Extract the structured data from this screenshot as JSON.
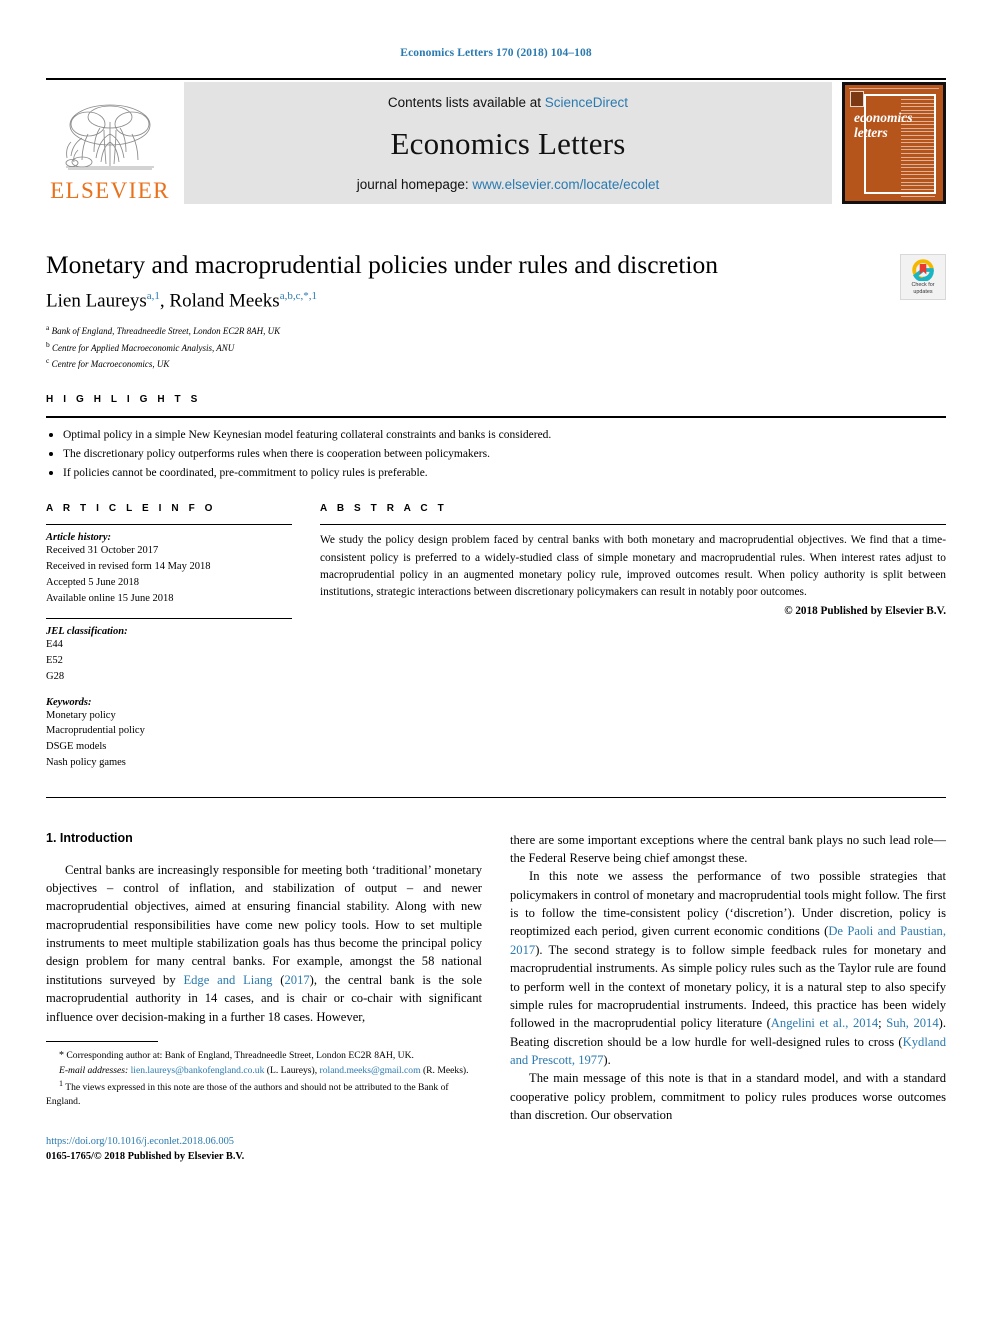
{
  "running_head": "Economics Letters 170 (2018) 104–108",
  "masthead": {
    "publisher_name": "ELSEVIER",
    "contents_prefix": "Contents lists available at",
    "contents_link": "ScienceDirect",
    "journal_name": "Economics Letters",
    "homepage_prefix": "journal homepage:",
    "homepage_link": "www.elsevier.com/locate/ecolet",
    "cover_title_line1": "economics",
    "cover_title_line2": "letters"
  },
  "title_block": {
    "title": "Monetary and macroprudential policies under rules and discretion",
    "authors_part1": "Lien Laureys",
    "authors_sup1": "a,1",
    "authors_sep": ", ",
    "authors_part2": "Roland Meeks",
    "authors_sup2": "a,b,c,*,1",
    "affiliations": [
      {
        "mark": "a",
        "text": "Bank of England, Threadneedle Street, London EC2R 8AH, UK"
      },
      {
        "mark": "b",
        "text": "Centre for Applied Macroeconomic Analysis, ANU"
      },
      {
        "mark": "c",
        "text": "Centre for Macroeconomics, UK"
      }
    ],
    "crossmark_line1": "Check for",
    "crossmark_line2": "updates"
  },
  "highlights": {
    "heading": "H I G H L I G H T S",
    "items": [
      "Optimal policy in a simple New Keynesian model featuring collateral constraints and banks is considered.",
      "The discretionary policy outperforms rules when there is cooperation between policymakers.",
      "If policies cannot be coordinated, pre-commitment to policy rules is preferable."
    ]
  },
  "article_info": {
    "heading": "A R T I C L E   I N F O",
    "history_label": "Article history:",
    "history": [
      "Received 31 October 2017",
      "Received in revised form 14 May 2018",
      "Accepted 5 June 2018",
      "Available online 15 June 2018"
    ],
    "jel_label": "JEL classification:",
    "jel_codes": [
      "E44",
      "E52",
      "G28"
    ],
    "keywords_label": "Keywords:",
    "keywords": [
      "Monetary policy",
      "Macroprudential policy",
      "DSGE models",
      "Nash policy games"
    ]
  },
  "abstract": {
    "heading": "A B S T R A C T",
    "text": "We study the policy design problem faced by central banks with both monetary and macroprudential objectives. We find that a time-consistent policy is preferred to a widely-studied class of simple monetary and macroprudential rules. When interest rates adjust to macroprudential policy in an augmented monetary policy rule, improved outcomes result. When policy authority is split between institutions, strategic interactions between discretionary policymakers can result in notably poor outcomes.",
    "copyright": "© 2018 Published by Elsevier B.V."
  },
  "body": {
    "section_title": "1. Introduction",
    "left_p1_a": "Central banks are increasingly responsible for meeting both ‘traditional’ monetary objectives – control of inflation, and stabilization of output – and newer macroprudential objectives, aimed at ensuring financial stability. Along with new macroprudential responsibilities have come new policy tools. How to set multiple instruments to meet multiple stabilization goals has thus become the principal policy design problem for many central banks. For example, amongst the 58 national institutions surveyed by ",
    "left_p1_cite1": "Edge and Liang",
    "left_p1_b": " (",
    "left_p1_cite2": "2017",
    "left_p1_c": "), the central bank is the sole macroprudential authority in 14 cases, and is chair or co-chair with significant influence over decision-making in a further 18 cases. However,",
    "right_p1": "there are some important exceptions where the central bank plays no such lead role—the Federal Reserve being chief amongst these.",
    "right_p2_a": "In this note we assess the performance of two possible strategies that policymakers in control of monetary and macroprudential tools might follow. The first is to follow the time-consistent policy (‘discretion’). Under discretion, policy is reoptimized each period, given current economic conditions (",
    "right_p2_cite1": "De Paoli and Paustian, 2017",
    "right_p2_b": "). The second strategy is to follow simple feedback rules for monetary and macroprudential instruments. As simple policy rules such as the Taylor rule are found to perform well in the context of monetary policy, it is a natural step to also specify simple rules for macroprudential instruments. Indeed, this practice has been widely followed in the macroprudential policy literature (",
    "right_p2_cite2": "Angelini et al., 2014",
    "right_p2_c": "; ",
    "right_p2_cite3": "Suh, 2014",
    "right_p2_d": "). Beating discretion should be a low hurdle for well-designed rules to cross (",
    "right_p2_cite4": "Kydland and Prescott, 1977",
    "right_p2_e": ").",
    "right_p3": "The main message of this note is that in a standard model, and with a standard cooperative policy problem, commitment to policy rules produces worse outcomes than discretion. Our observation"
  },
  "footnotes": {
    "corresponding_mark": "*",
    "corresponding_text": " Corresponding author at: Bank of England, Threadneedle Street, London EC2R 8AH, UK.",
    "email_label": "E-mail addresses:",
    "email1": "lien.laureys@bankofengland.co.uk",
    "email1_who": " (L. Laureys),",
    "email2": "roland.meeks@gmail.com",
    "email2_who": " (R. Meeks).",
    "fn1_mark": "1",
    "fn1_text": " The views expressed in this note are those of the authors and should not be attributed to the Bank of England."
  },
  "doi_block": {
    "doi": "https://doi.org/10.1016/j.econlet.2018.06.005",
    "issn": "0165-1765/© 2018 Published by Elsevier B.V."
  },
  "colors": {
    "link_blue": "#2a7ab0",
    "elsevier_orange": "#E9711C",
    "cover_brown": "#B5551C",
    "masthead_grey": "#e3e3e3"
  }
}
